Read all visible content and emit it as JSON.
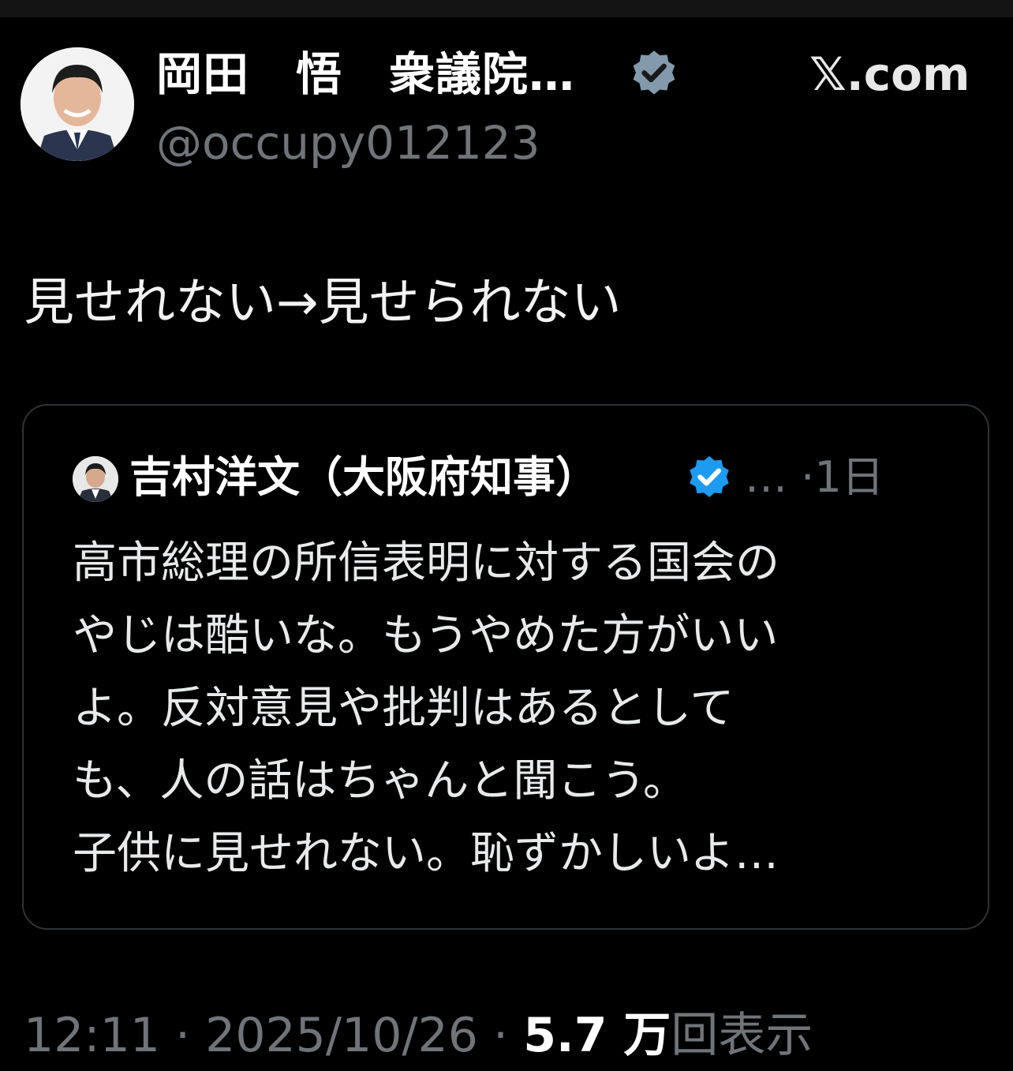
{
  "colors": {
    "background": "#000000",
    "text_primary": "#ffffff",
    "text_secondary": "#6f7479",
    "verified_blue": "#1d9bf0",
    "verified_gray": "#829aab",
    "card_border": "#2f3336"
  },
  "author": {
    "name": "岡田　悟　衆議院…",
    "handle": "@occupy012123",
    "badge_icon": "verified-gray-icon",
    "avatar_icon": "avatar-photo"
  },
  "site": {
    "label": "𝕏.com"
  },
  "tweet": {
    "text": "見せれない→見せられない"
  },
  "quote": {
    "author_name": "吉村洋文（大阪府知事）",
    "badge_icon": "verified-blue-icon",
    "meta": "… ·1日",
    "lines": [
      "高市総理の所信表明に対する国会の",
      "やじは酷いな。もうやめた方がいい",
      "よ。反対意見や批判はあるとして",
      "も、人の話はちゃんと聞こう。",
      "子供に見せれない。恥ずかしいよ…"
    ]
  },
  "footer": {
    "time": "12:11",
    "sep1": " · ",
    "date": "2025/10/26",
    "sep2": " · ",
    "views_count": "5.7 万",
    "views_label": "回表示"
  }
}
